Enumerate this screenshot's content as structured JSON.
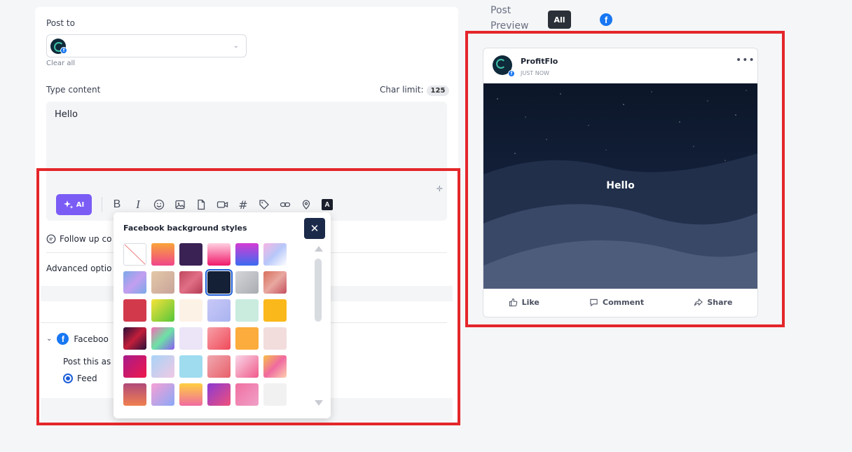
{
  "composer": {
    "post_to_label": "Post to",
    "clear_all": "Clear all",
    "type_content_label": "Type content",
    "char_limit_label": "Char limit:",
    "char_limit_value": "125",
    "content": "Hello",
    "ai_label": "AI",
    "follow_up": "Follow up co",
    "advanced_options": "Advanced optio",
    "facebook_section": "Faceboo",
    "post_this_as": "Post this as",
    "feed_option": "Feed"
  },
  "toolbar_icons": [
    "bold-icon",
    "italic-icon",
    "emoji-icon",
    "image-icon",
    "document-icon",
    "video-icon",
    "hashtag-icon",
    "tag-icon",
    "link-icon",
    "location-icon",
    "text-style-icon"
  ],
  "background_picker": {
    "title": "Facebook background styles",
    "selected_index": 9,
    "swatches": [
      "none",
      "linear-gradient(180deg,#f9a43a,#f0458a)",
      "#3a2255",
      "linear-gradient(180deg,#ffd0e0,#f0186a)",
      "linear-gradient(180deg,#d43bd4,#3b6cf0)",
      "linear-gradient(135deg,#f7b6e3,#b7c7f9,#fff)",
      "linear-gradient(135deg,#7aa9e8,#c39ef0,#7aa9e8)",
      "linear-gradient(135deg,#e4c8a8,#c8a49a)",
      "linear-gradient(135deg,#c0495f,#e06f86,#b23a52)",
      "#142036",
      "linear-gradient(135deg,#d4d6d9,#a9acb1)",
      "linear-gradient(135deg,#d96f5c,#e8a8a0,#c44f5e)",
      "#d23a4c",
      "linear-gradient(135deg,#f7e23a,#56c63a)",
      "#fdf2e6",
      "linear-gradient(135deg,#c8c8f7,#aab4f0)",
      "#c9ecdf",
      "#fbb81b",
      "linear-gradient(135deg,#2a0f3a,#c21e3a,#2a0f3a)",
      "linear-gradient(135deg,#f76bb5,#6ce2a5,#8a5ef0)",
      "#ece4f7",
      "linear-gradient(135deg,#f6a0a8,#f04a5a)",
      "#fbac3c",
      "#f3dcdc",
      "linear-gradient(135deg,#a81a8a,#f0184a)",
      "linear-gradient(135deg,#a8d4f7,#f0c8e4)",
      "#9fdcf0",
      "linear-gradient(135deg,#f0a8b0,#e8606a)",
      "linear-gradient(135deg,#f9d8e8,#f05a8a)",
      "linear-gradient(135deg,#f7c04a,#f06aa0,#fdd0b0)",
      "linear-gradient(180deg,#b04a7a,#f08050)",
      "linear-gradient(135deg,#f7a0d4,#8aa8f7)",
      "linear-gradient(180deg,#ffd040,#f06aa0)",
      "linear-gradient(135deg,#8a3ad4,#f0507a)",
      "linear-gradient(135deg,#f070a0,#f0a0c8)",
      "#f1f1f2"
    ]
  },
  "preview": {
    "title": "Post Preview",
    "all_label": "All",
    "account_name": "ProfitFlo",
    "timestamp": "JUST NOW",
    "post_text": "Hello",
    "like": "Like",
    "comment": "Comment",
    "share": "Share"
  },
  "colors": {
    "accent": "#7b5cf5",
    "highlight": "#e4262a",
    "facebook": "#1877f2"
  }
}
